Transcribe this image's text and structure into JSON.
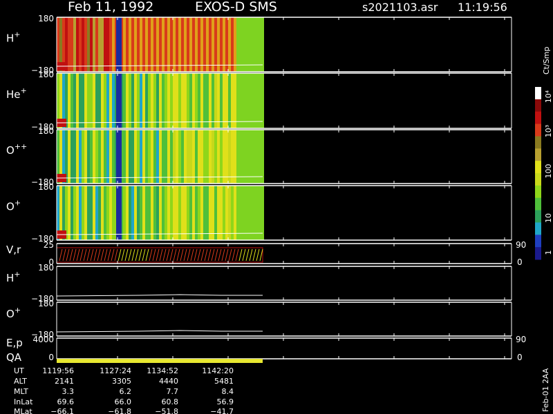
{
  "header": {
    "date": "Feb 11, 1992",
    "mission": "EXOS-D SMS",
    "file": "s2021103.asr",
    "time": "11:19:56"
  },
  "colorbar": {
    "units": "Ct/Smp",
    "tick_labels": [
      "1",
      "10",
      "100",
      "10³",
      "10⁴"
    ],
    "colors": [
      "#1a1a8c",
      "#1f3fbf",
      "#1fa6c8",
      "#2ca05a",
      "#4fbf3a",
      "#8fd61a",
      "#c8d81a",
      "#e0e01a",
      "#b8a030",
      "#8a7a20",
      "#d83a1a",
      "#c01010",
      "#8a0a0a",
      "#ffffff"
    ]
  },
  "panels": [
    {
      "id": "H+",
      "label": "H",
      "sup": "+",
      "ymax": "180",
      "ymin": "−180",
      "kind": "spectrogram"
    },
    {
      "id": "He+",
      "label": "He",
      "sup": "+",
      "ymax": "180",
      "ymin": "−180",
      "kind": "spectrogram"
    },
    {
      "id": "O++",
      "label": "O",
      "sup": "++",
      "ymax": "180",
      "ymin": "−180",
      "kind": "spectrogram"
    },
    {
      "id": "O+",
      "label": "O",
      "sup": "+",
      "ymax": "180",
      "ymin": "−180",
      "kind": "spectrogram"
    },
    {
      "id": "Vr",
      "label": "V,r",
      "sup": "",
      "ymax": "25",
      "ymin": "0",
      "right_max": "90",
      "right_min": "0",
      "kind": "vr"
    },
    {
      "id": "H+line",
      "label": "H",
      "sup": "+",
      "ymax": "180",
      "ymin": "−180",
      "kind": "line"
    },
    {
      "id": "O+line",
      "label": "O",
      "sup": "+",
      "ymax": "180",
      "ymin": "−180",
      "kind": "line"
    },
    {
      "id": "Ep",
      "label": "E,p",
      "sup": "",
      "ymax": "4000",
      "ymin": "0",
      "right_max": "90",
      "right_min": "0",
      "kind": "ep"
    },
    {
      "id": "QA",
      "label": "QA",
      "sup": "",
      "kind": "qa"
    }
  ],
  "footer": {
    "row_labels": [
      "UT",
      "ALT",
      "MLT",
      "InLat",
      "MLat"
    ],
    "columns": [
      [
        "1119:56",
        "2141",
        "3.3",
        "69.6",
        "−66.1"
      ],
      [
        "1127:24",
        "3305",
        "6.2",
        "66.0",
        "−61.8"
      ],
      [
        "1134:52",
        "4440",
        "7.7",
        "60.8",
        "−51.8"
      ],
      [
        "1142:20",
        "5481",
        "8.4",
        "56.9",
        "−41.7"
      ]
    ],
    "side_note": "Feb-01 2AA"
  },
  "chart_data": {
    "type": "heatmap",
    "title": "Feb 11, 1992   EXOS-D SMS",
    "xlabel": "UT",
    "x_ticks": [
      "1119:56",
      "1127:24",
      "1134:52",
      "1142:20"
    ],
    "ylim": [
      -180,
      180
    ],
    "series": [
      {
        "name": "H+"
      },
      {
        "name": "He+"
      },
      {
        "name": "O++"
      },
      {
        "name": "O+"
      }
    ],
    "colorbar_scale": "log",
    "colorbar_range": [
      1,
      10000
    ]
  }
}
